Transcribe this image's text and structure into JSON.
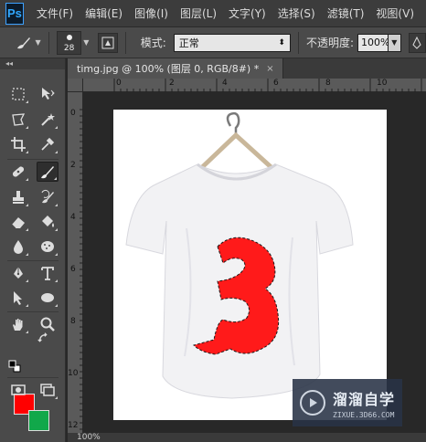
{
  "app": {
    "logo": "Ps",
    "menu": [
      "文件(F)",
      "编辑(E)",
      "图像(I)",
      "图层(L)",
      "文字(Y)",
      "选择(S)",
      "滤镜(T)",
      "视图(V)"
    ]
  },
  "options": {
    "brush_size": "28",
    "mode_label": "模式:",
    "mode_value": "正常",
    "opacity_label": "不透明度:",
    "opacity_value": "100%"
  },
  "toolbox": {
    "collapse": "◂◂",
    "foreground_color": "#ff0000",
    "background_color": "#11a84a",
    "active_tool": "brush-tool"
  },
  "document": {
    "tab_title": "timg.jpg @ 100% (图层 0, RGB/8#) *",
    "tab_close": "×",
    "ruler_h_labels": [
      "0",
      "2",
      "4",
      "6",
      "8",
      "10"
    ],
    "ruler_v_labels": [
      "0",
      "2",
      "4",
      "6",
      "8",
      "10",
      "12"
    ],
    "zoom": "100%"
  },
  "watermark": {
    "title": "溜溜自学",
    "subtitle": "ZIXUE.3D66.COM"
  },
  "colors": {
    "shirt": "#f2f2f4",
    "paint": "#ff1a1a"
  }
}
